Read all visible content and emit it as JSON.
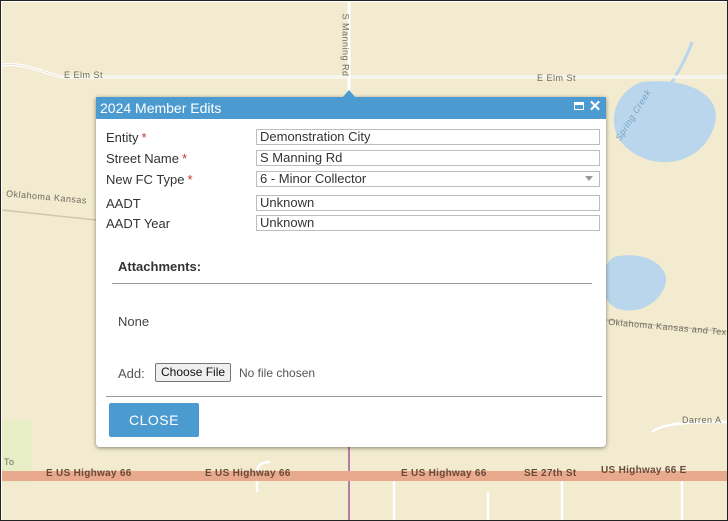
{
  "map": {
    "colors": {
      "land": "#f2ebcf",
      "water": "#b9d6ec",
      "highway": "#e9a98d",
      "road": "#ffffff",
      "boundary": "#b57aa8"
    },
    "labels": {
      "elm_west": "E Elm St",
      "elm_east": "E Elm St",
      "manning": "S Manning Rd",
      "creek": "Spring Creek",
      "oklahoma_west": "Oklahoma Kansas",
      "oklahoma_east": "Oklahoma Kansas and Tex",
      "darren": "Darren A",
      "hwy1": "E US Highway 66",
      "hwy2": "E US Highway 66",
      "hwy3": "E US Highway 66",
      "hwy4": "SE 27th St",
      "hwy5": "US Highway 66 E",
      "left_edge": "To"
    }
  },
  "popup": {
    "title": "2024 Member Edits",
    "maximize_icon": "maximize-icon",
    "close_icon": "close-x-icon",
    "close_glyph": "✕",
    "required_mark": "*",
    "fields": {
      "entity": {
        "label": "Entity",
        "value": "Demonstration City"
      },
      "street_name": {
        "label": "Street Name",
        "value": "S Manning Rd"
      },
      "fc_type": {
        "label": "New FC Type",
        "value": "6 - Minor Collector"
      },
      "aadt": {
        "label": "AADT",
        "value": "Unknown"
      },
      "aadt_year": {
        "label": "AADT Year",
        "value": "Unknown"
      }
    },
    "attachments": {
      "title": "Attachments:",
      "none": "None",
      "add_label": "Add:",
      "choose_file": "Choose File",
      "no_file": "No file chosen"
    },
    "close_label": "CLOSE"
  }
}
